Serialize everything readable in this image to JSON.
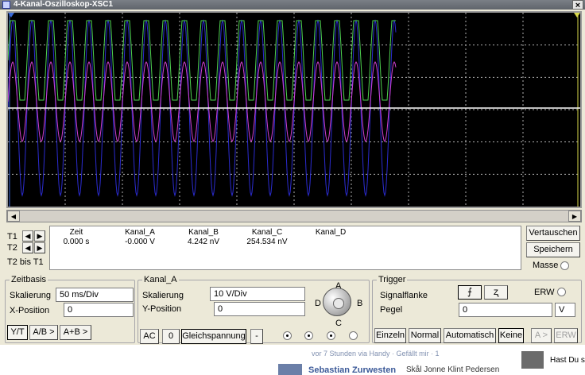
{
  "window": {
    "title": "4-Kanal-Oszilloskop-XSC1",
    "close": "×"
  },
  "colors": {
    "channel_a": "#4fd24f",
    "channel_b": "#d040d0",
    "channel_c": "#2b2bd0",
    "channel_d": "#ffffff",
    "grid": "#b0b0b0"
  },
  "cursors": {
    "t1": "T1",
    "t2": "T2",
    "diff": "T2 bis T1"
  },
  "readout": {
    "headers": [
      "Zeit",
      "Kanal_A",
      "Kanal_B",
      "Kanal_C",
      "Kanal_D"
    ],
    "values": [
      "0.000 s",
      "-0.000 V",
      "4.242 nV",
      "254.534 nV",
      ""
    ]
  },
  "right_buttons": {
    "reverse": "Vertauschen",
    "save": "Speichern",
    "ground": "Masse"
  },
  "timebase": {
    "title": "Zeitbasis",
    "scale_label": "Skalierung",
    "scale": "50 ms/Div",
    "xpos_label": "X-Position",
    "xpos": "0",
    "modes": [
      "Y/T",
      "A/B >",
      "A+B >"
    ]
  },
  "channel": {
    "title": "Kanal_A",
    "scale_label": "Skalierung",
    "scale": "10  V/Div",
    "ypos_label": "Y-Position",
    "ypos": "0",
    "ac": "AC",
    "zero": "0",
    "dc": "Gleichspannung",
    "minus": "-",
    "knob_labels": [
      "A",
      "B",
      "C",
      "D"
    ]
  },
  "trigger": {
    "title": "Trigger",
    "edge_label": "Signalflanke",
    "level_label": "Pegel",
    "level": "0",
    "unit": "V",
    "ext": "ERW",
    "buttons": [
      "Einzeln",
      "Normal",
      "Automatisch",
      "Keine"
    ],
    "src": "A >",
    "ext_btn": "ERW"
  },
  "background_feed": {
    "line1": "vor 7 Stunden via Handy · Gefällt mir · 1",
    "name": "Sebastian Zurwesten",
    "text": "Skål Jonne Klint Pedersen",
    "side": "Hast Du s"
  }
}
